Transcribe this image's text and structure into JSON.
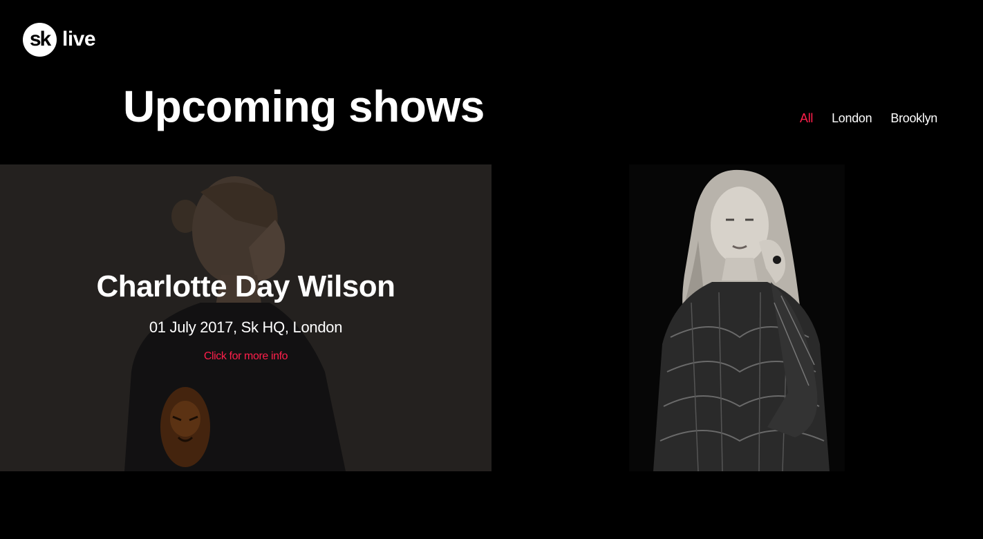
{
  "brand": {
    "mark": "sk",
    "name": "live"
  },
  "page_title": "Upcoming shows",
  "filters": [
    {
      "label": "All",
      "active": true
    },
    {
      "label": "London",
      "active": false
    },
    {
      "label": "Brooklyn",
      "active": false
    }
  ],
  "shows": [
    {
      "artist": "Charlotte Day Wilson",
      "details": "01 July 2017, Sk HQ, London",
      "link_label": "Click for more info"
    }
  ],
  "colors": {
    "background": "#000000",
    "text": "#ffffff",
    "accent": "#ff1f4b"
  }
}
